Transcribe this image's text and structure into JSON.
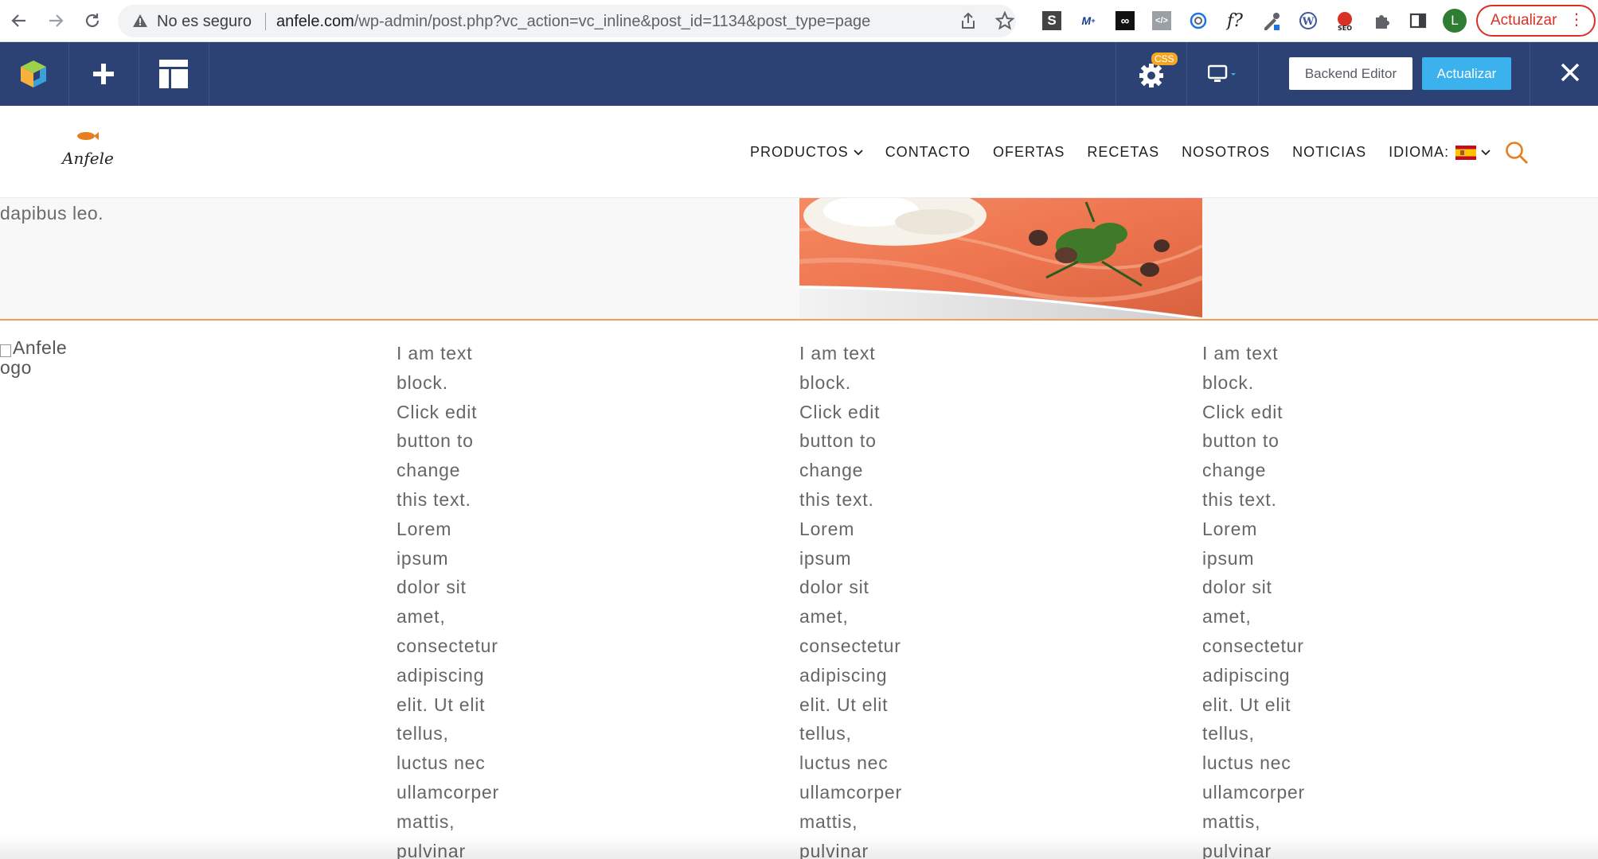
{
  "browser": {
    "security_text": "No es seguro",
    "url_host": "anfele.com",
    "url_path": "/wp-admin/post.php?vc_action=vc_inline&post_id=1134&post_type=page",
    "profile_initial": "L",
    "update_label": "Actualizar",
    "extensions": [
      "s-extension-icon",
      "movistar-extension-icon",
      "infinity-extension-icon",
      "code-extension-icon",
      "spiral-extension-icon",
      "font-extension-icon",
      "eyedropper-extension-icon",
      "wordpress-extension-icon",
      "seo-extension-icon",
      "puzzle-extensions-icon",
      "side-panel-icon"
    ]
  },
  "vc_toolbar": {
    "css_badge": "CSS",
    "backend_editor_label": "Backend Editor",
    "update_label": "Actualizar",
    "accent": "#3bb1ee",
    "bg": "#2c4274"
  },
  "site_header": {
    "logo_text": "Anfele",
    "nav": [
      {
        "label": "PRODUCTOS",
        "dropdown": true
      },
      {
        "label": "CONTACTO",
        "dropdown": false
      },
      {
        "label": "OFERTAS",
        "dropdown": false
      },
      {
        "label": "RECETAS",
        "dropdown": false
      },
      {
        "label": "NOSOTROS",
        "dropdown": false
      },
      {
        "label": "NOTICIAS",
        "dropdown": false
      },
      {
        "label": "IDIOMA:",
        "dropdown": true
      }
    ],
    "accent": "#e67e22"
  },
  "content": {
    "dapibus_text": "dapibus leo.",
    "logo_alt_line1": "Anfele",
    "logo_alt_line2": "ogo",
    "text_block_lines": [
      "I am text",
      "block.",
      "Click edit",
      "button to",
      "change",
      "this text.",
      "Lorem",
      "ipsum",
      "dolor sit",
      "amet,",
      "consectetur",
      "adipiscing",
      "elit. Ut elit",
      "tellus,",
      "luctus nec",
      "ullamcorper",
      "mattis,",
      "pulvinar"
    ]
  }
}
